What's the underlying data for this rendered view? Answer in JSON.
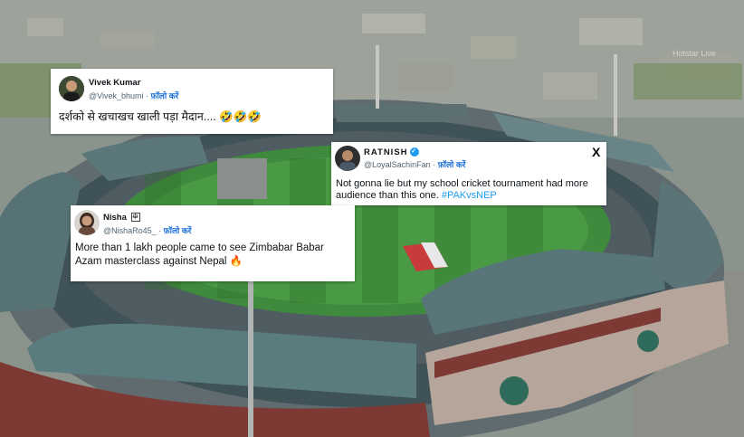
{
  "watermark": "Hotstar Live",
  "tweets": [
    {
      "name": "Vivek Kumar",
      "handle": "@Vivek_bhumi",
      "follow": "फ़ॉलो करें",
      "text": "दर्शको से खचाखच खाली पड़ा मैदान.... 🤣🤣🤣",
      "avatar_icon": "person-photo"
    },
    {
      "name": "RATNISH",
      "handle": "@LoyalSachinFan",
      "follow": "फ़ॉलो करें",
      "text": "Not gonna lie but my school cricket tournament had more audience than this one.",
      "hashtag": "#PAKvsNEP",
      "verified": true,
      "logo": "X",
      "avatar_icon": "person-photo"
    },
    {
      "name": "Nisha",
      "name_suffix": "⯐",
      "handle": "@NishaRo45_",
      "follow": "फ़ॉलो करें",
      "text": "More than 1 lakh people came to see Zimbabar Babar Azam masterclass against Nepal 🔥",
      "avatar_icon": "person-photo"
    }
  ]
}
